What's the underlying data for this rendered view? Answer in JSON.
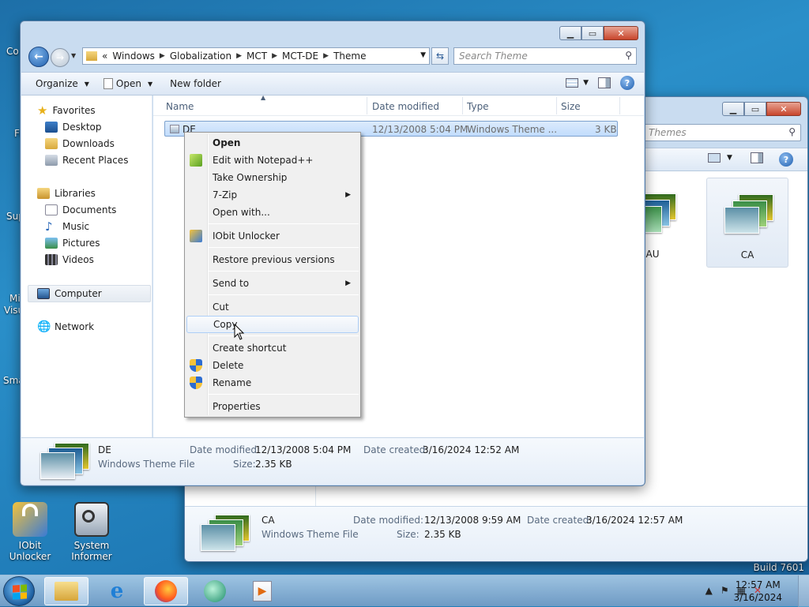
{
  "desktop": {
    "icons": [
      {
        "label_line1": "IObit",
        "label_line2": "Unlocker"
      },
      {
        "label_line1": "System",
        "label_line2": "Informer"
      }
    ],
    "partial_labels": [
      "Co",
      "Fi",
      "Sup",
      "Mi",
      "Visu",
      "Sma"
    ],
    "build": "Build 7601"
  },
  "back_window": {
    "search_placeholder": "Themes",
    "thumbnails": [
      {
        "label": "AU"
      },
      {
        "label": "CA"
      }
    ],
    "details": {
      "name": "CA",
      "type": "Windows Theme File",
      "date_modified_label": "Date modified:",
      "date_modified": "12/13/2008 9:59 AM",
      "date_created_label": "Date created:",
      "date_created": "3/16/2024 12:57 AM",
      "size_label": "Size:",
      "size": "2.35 KB"
    }
  },
  "window": {
    "address": {
      "overflow": "«",
      "crumbs": [
        "Windows",
        "Globalization",
        "MCT",
        "MCT-DE",
        "Theme"
      ]
    },
    "search_placeholder": "Search Theme",
    "toolbar": {
      "organize": "Organize",
      "open": "Open",
      "new_folder": "New folder"
    },
    "nav": {
      "favorites": "Favorites",
      "desktop": "Desktop",
      "downloads": "Downloads",
      "recent": "Recent Places",
      "libraries": "Libraries",
      "documents": "Documents",
      "music": "Music",
      "pictures": "Pictures",
      "videos": "Videos",
      "computer": "Computer",
      "network": "Network"
    },
    "columns": {
      "name": "Name",
      "date": "Date modified",
      "type": "Type",
      "size": "Size"
    },
    "file": {
      "name": "DE",
      "date": "12/13/2008 5:04 PM",
      "type": "Windows Theme ...",
      "size": "3 KB"
    },
    "details": {
      "name": "DE",
      "type": "Windows Theme File",
      "date_modified_label": "Date modified:",
      "date_modified": "12/13/2008 5:04 PM",
      "date_created_label": "Date created:",
      "date_created": "3/16/2024 12:52 AM",
      "size_label": "Size:",
      "size": "2.35 KB"
    }
  },
  "context_menu": {
    "items": [
      {
        "label": "Open"
      },
      {
        "label": "Edit with Notepad++"
      },
      {
        "label": "Take Ownership"
      },
      {
        "label": "7-Zip"
      },
      {
        "label": "Open with..."
      },
      {
        "label": "IObit Unlocker"
      },
      {
        "label": "Restore previous versions"
      },
      {
        "label": "Send to"
      },
      {
        "label": "Cut"
      },
      {
        "label": "Copy"
      },
      {
        "label": "Create shortcut"
      },
      {
        "label": "Delete"
      },
      {
        "label": "Rename"
      },
      {
        "label": "Properties"
      }
    ]
  },
  "taskbar": {
    "time": "12:57 AM",
    "date": "3/16/2024"
  },
  "colors": {
    "selection": "#c1dcfc",
    "accent": "#1f5fad"
  }
}
